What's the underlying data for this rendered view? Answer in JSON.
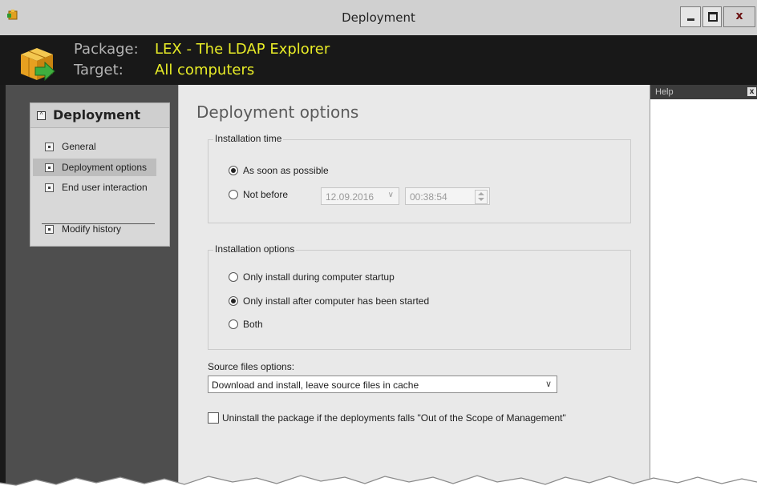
{
  "window": {
    "title": "Deployment",
    "buttons": {
      "minimize": "minimize",
      "maximize": "maximize",
      "close_glyph": "x"
    }
  },
  "header": {
    "package_label": "Package:",
    "package_value": "LEX - The LDAP Explorer",
    "target_label": "Target:",
    "target_value": "All computers"
  },
  "sidebar": {
    "section_title": "Deployment",
    "items": [
      {
        "label": "General",
        "active": false
      },
      {
        "label": "Deployment options",
        "active": true
      },
      {
        "label": "End user interaction",
        "active": false
      }
    ],
    "extra_items": [
      {
        "label": "Modify history"
      }
    ]
  },
  "main": {
    "title": "Deployment options",
    "installation_time": {
      "label": "Installation time",
      "options": [
        {
          "label": "As soon as possible",
          "checked": true
        },
        {
          "label": "Not before",
          "checked": false
        }
      ],
      "date_value": "12.09.2016",
      "time_value": "00:38:54"
    },
    "installation_options": {
      "label": "Installation options",
      "options": [
        {
          "label": "Only install during computer startup",
          "checked": false
        },
        {
          "label": "Only install after computer has been started",
          "checked": true
        },
        {
          "label": "Both",
          "checked": false
        }
      ]
    },
    "source_files": {
      "label": "Source files options:",
      "selected": "Download and install, leave source files in cache"
    },
    "uninstall_checkbox": {
      "label": "Uninstall the package if the deployments falls \"Out of the Scope of Management\"",
      "checked": false
    }
  },
  "help_panel": {
    "title": "Help",
    "close_glyph": "x"
  },
  "colors": {
    "header_value": "#e8ec27",
    "header_label": "#b4b4b4",
    "sidebar_bg": "#4e4e4e",
    "main_bg": "#e9e9e9"
  },
  "icons": {
    "app": "package-app-icon",
    "package": "package-box-arrow-icon"
  }
}
